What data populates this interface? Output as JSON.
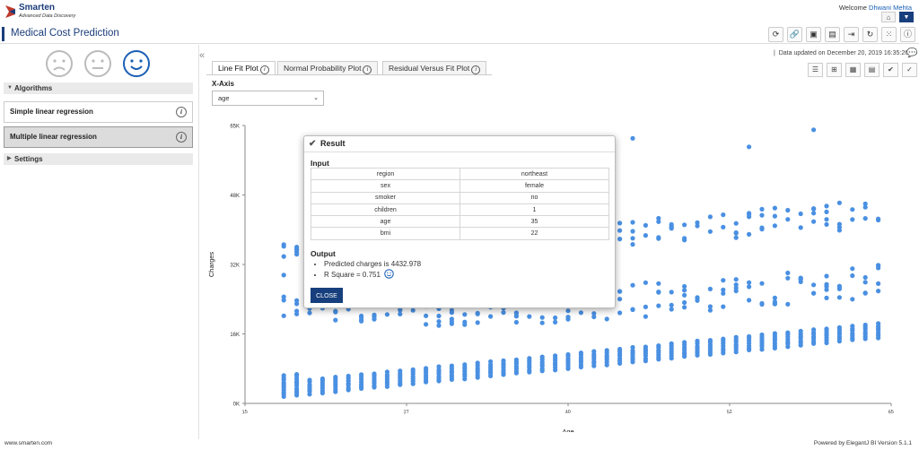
{
  "header": {
    "logo_name": "Smarten",
    "logo_tagline": "Advanced Data Discovery",
    "welcome_prefix": "Welcome",
    "user_name": "Dhwani Mehta",
    "home_icon": "home-icon",
    "dropdown_icon": "caret-down-icon"
  },
  "title": "Medical Cost Prediction",
  "toolbar_icons": [
    "refresh-icon",
    "link-icon",
    "save-icon",
    "save-as-icon",
    "export-icon",
    "share-icon",
    "grid-icon",
    "info-icon"
  ],
  "feedback": [
    "sad-face-icon",
    "neutral-face-icon",
    "happy-face-icon"
  ],
  "left": {
    "algorithms_label": "Algorithms",
    "items": [
      {
        "label": "Simple linear regression",
        "active": false
      },
      {
        "label": "Multiple linear regression",
        "active": true
      }
    ],
    "settings_label": "Settings"
  },
  "status": "Data updated on December 20, 2019 16:35:26",
  "tabs": [
    {
      "label": "Line Fit Plot",
      "active": true
    },
    {
      "label": "Normal Probability Plot",
      "active": false
    },
    {
      "label": "Residual Versus Fit Plot",
      "active": false
    }
  ],
  "chart_tools": [
    "list-icon",
    "tree-icon",
    "table-icon",
    "table-alt-icon",
    "double-check-icon",
    "check-icon"
  ],
  "xaxis": {
    "label": "X-Axis",
    "selected": "age"
  },
  "chart_data": {
    "type": "scatter",
    "xlabel": "Age",
    "ylabel": "Charges",
    "xlim": [
      15,
      65
    ],
    "ylim": [
      0,
      65000
    ],
    "xticks": [
      "15",
      "27",
      "40",
      "52",
      "65"
    ],
    "yticks": [
      "0K",
      "16K",
      "32K",
      "48K",
      "65K"
    ],
    "grid": false,
    "color": "#4a90e2",
    "ages": [
      18,
      19,
      20,
      21,
      22,
      23,
      24,
      25,
      26,
      27,
      28,
      29,
      30,
      31,
      32,
      33,
      34,
      35,
      36,
      37,
      38,
      39,
      40,
      41,
      42,
      43,
      44,
      45,
      46,
      47,
      48,
      49,
      50,
      51,
      52,
      53,
      54,
      55,
      56,
      57,
      58,
      59,
      60,
      61,
      62,
      63,
      64
    ],
    "band_low_base": 1500,
    "band_low_slope": 300,
    "band_mid": [
      [
        18,
        20000,
        38000
      ],
      [
        30,
        18000,
        36000
      ],
      [
        40,
        19000,
        42000
      ],
      [
        50,
        21000,
        44000
      ],
      [
        64,
        24000,
        48000
      ]
    ],
    "outliers": [
      [
        18,
        30000
      ],
      [
        19,
        36000
      ],
      [
        22,
        38000
      ],
      [
        45,
        62000
      ],
      [
        54,
        60000
      ],
      [
        59,
        64000
      ]
    ]
  },
  "modal": {
    "title": "Result",
    "input_label": "Input",
    "inputs": [
      {
        "key": "region",
        "value": "northeast"
      },
      {
        "key": "sex",
        "value": "female"
      },
      {
        "key": "smoker",
        "value": "no"
      },
      {
        "key": "children",
        "value": "1"
      },
      {
        "key": "age",
        "value": "35"
      },
      {
        "key": "bmi",
        "value": "22"
      }
    ],
    "output_label": "Output",
    "output_lines": [
      "Predicted charges is 4432.978",
      "R Square = 0.751"
    ],
    "close_label": "CLOSE"
  },
  "footer": {
    "left": "www.smarten.com",
    "right": "Powered by ElegantJ BI Version 5.1.1"
  }
}
